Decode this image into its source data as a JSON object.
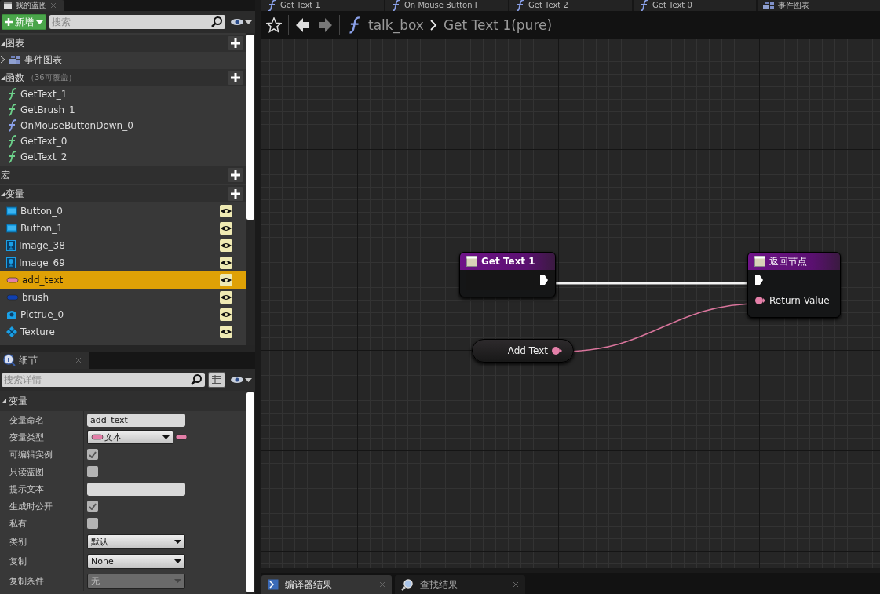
{
  "my_blueprint": {
    "title": "我的蓝图",
    "add_button": "新增",
    "search": {
      "placeholder": "搜索"
    },
    "sections": [
      {
        "title": "图表",
        "expanded": true,
        "items": [
          {
            "label": "事件图表",
            "kind": "graph",
            "expanded": false
          }
        ]
      },
      {
        "title": "函数",
        "note": "（36可覆盖）",
        "expanded": true,
        "items": [
          {
            "label": "GetText_1",
            "kind": "function"
          },
          {
            "label": "GetBrush_1",
            "kind": "function"
          },
          {
            "label": "OnMouseButtonDown_0",
            "kind": "override"
          },
          {
            "label": "GetText_0",
            "kind": "function"
          },
          {
            "label": "GetText_2",
            "kind": "function"
          }
        ]
      },
      {
        "title": "宏"
      },
      {
        "title": "变量",
        "expanded": true,
        "items": [
          {
            "label": "Button_0",
            "kind": "button",
            "selected": false
          },
          {
            "label": "Button_1",
            "kind": "button",
            "selected": false
          },
          {
            "label": "Image_38",
            "kind": "image",
            "selected": false
          },
          {
            "label": "Image_69",
            "kind": "image",
            "selected": false
          },
          {
            "label": "add_text",
            "kind": "text",
            "selected": true
          },
          {
            "label": "brush",
            "kind": "brush",
            "selected": false
          },
          {
            "label": "Pictrue_0",
            "kind": "picture",
            "selected": false
          },
          {
            "label": "Texture",
            "kind": "texture",
            "selected": false
          }
        ]
      }
    ]
  },
  "details": {
    "title": "细节",
    "search": {
      "placeholder": "搜索详情"
    },
    "section": "变量",
    "properties": [
      {
        "label": "变量命名",
        "kind": "text",
        "value": "add_text"
      },
      {
        "label": "变量类型",
        "kind": "type",
        "value": "文本"
      },
      {
        "label": "可编辑实例",
        "kind": "check",
        "checked": true
      },
      {
        "label": "只读蓝图",
        "kind": "check",
        "checked": false
      },
      {
        "label": "提示文本",
        "kind": "text"
      },
      {
        "label": "生成时公开",
        "kind": "check",
        "checked": true
      },
      {
        "label": "私有",
        "kind": "check",
        "checked": false
      },
      {
        "label": "类别",
        "kind": "combo",
        "value": "默认",
        "disabled": false
      },
      {
        "label": "复制",
        "kind": "combo",
        "value": "None",
        "disabled": false
      },
      {
        "label": "复制条件",
        "kind": "combo",
        "value": "无",
        "disabled": true
      }
    ]
  },
  "document_tabs": [
    {
      "label": "Get Text 1",
      "kind": "function"
    },
    {
      "label": "On Mouse Button I",
      "kind": "function"
    },
    {
      "label": "Get Text 2",
      "kind": "function"
    },
    {
      "label": "Get Text 0",
      "kind": "function"
    },
    {
      "label": "事件图表",
      "kind": "graph"
    }
  ],
  "breadcrumb": [
    "talk_box",
    "Get Text 1(pure)"
  ],
  "graph": {
    "nodes": [
      {
        "kind": "entry",
        "title": "Get Text 1"
      },
      {
        "kind": "result",
        "title": "返回节点",
        "pin": "Return Value"
      },
      {
        "kind": "variable",
        "label": "Add Text"
      }
    ]
  },
  "bottom_tabs": [
    {
      "label": "编译器结果",
      "kind": "log",
      "selected": true
    },
    {
      "label": "查找结果",
      "kind": "find",
      "selected": false
    }
  ]
}
